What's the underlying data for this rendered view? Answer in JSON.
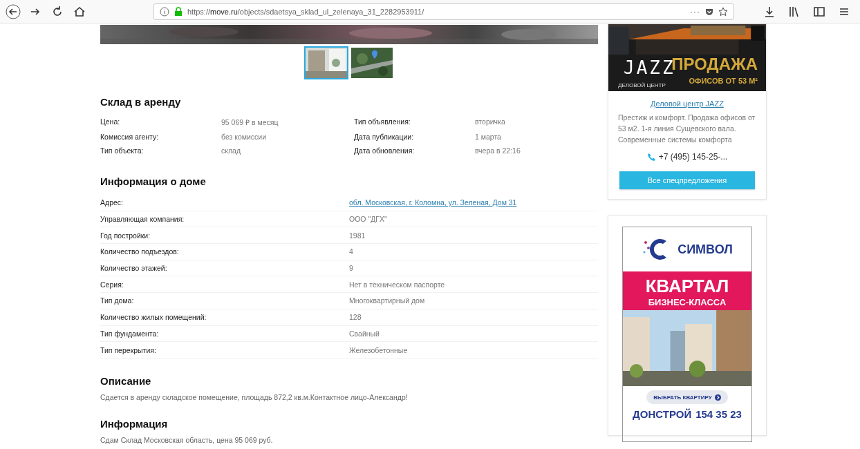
{
  "browser": {
    "url": "https://**move.ru**/objects/sdaetsya_sklad_ul_zelenaya_31_2282953911/",
    "page_actions": "···"
  },
  "gallery": {
    "thumbnails": [
      {
        "kind": "picture",
        "selected": true
      },
      {
        "kind": "map",
        "selected": false
      }
    ]
  },
  "listing": {
    "title": "Склад в аренду",
    "left_fields": [
      {
        "label": "Цена:",
        "value": "95 069 ₽ в месяц"
      },
      {
        "label": "Комиссия агенту:",
        "value": "без комиссии"
      },
      {
        "label": "Тип объекта:",
        "value": "склад"
      }
    ],
    "right_fields": [
      {
        "label": "Тип объявления:",
        "value": "вторичка"
      },
      {
        "label": "Дата публикации:",
        "value": "1 марта"
      },
      {
        "label": "Дата обновления:",
        "value": "вчера в 22:16"
      }
    ]
  },
  "house": {
    "title": "Информация о доме",
    "rows": [
      {
        "label": "Адрес:",
        "value": "обл. Московская, г. Коломна, ул. Зеленая, Дом 31",
        "kind": "link"
      },
      {
        "label": "Управляющая компания:",
        "value": "ООО \"ДГХ\"",
        "kind": "text"
      },
      {
        "label": "Год постройки:",
        "value": "1981",
        "kind": "text"
      },
      {
        "label": "Количество подъездов:",
        "value": "4",
        "kind": "text"
      },
      {
        "label": "Количество этажей:",
        "value": "9",
        "kind": "text"
      },
      {
        "label": "Серия:",
        "value": "Нет в техническом паспорте",
        "kind": "text"
      },
      {
        "label": "Тип дома:",
        "value": "Многоквартирный дом",
        "kind": "text"
      },
      {
        "label": "Количество жилых помещений:",
        "value": "128",
        "kind": "text"
      },
      {
        "label": "Тип фундамента:",
        "value": "Свайный",
        "kind": "text"
      },
      {
        "label": "Тип перекрытия:",
        "value": "Железобетонные",
        "kind": "text"
      }
    ]
  },
  "description": {
    "title": "Описание",
    "text": "Сдается в аренду складское помещение, площадь 872,2 кв.м.Контактное лицо-Александр!"
  },
  "information": {
    "title": "Информация",
    "text": "Сдам Склад Московская область, цена 95 069 руб."
  },
  "ad_jazz": {
    "logo": "JAZZ",
    "logo_caption": "ДЕЛОВОЙ ЦЕНТР",
    "headline": "ПРОДАЖА",
    "subline": "ОФИСОВ ОТ 53 М²",
    "link": "Деловой центр JAZZ",
    "text": "Престиж и комфорт. Продажа офисов от 53 м2. 1-я линия Сущевского вала. Современные системы комфорта",
    "phone": "+7 (495) 145-25-...",
    "button": "Все спецпредложения"
  },
  "ad_symbol": {
    "brand": "СИМВОЛ",
    "headline": "КВАРТАЛ",
    "subline": "БИЗНЕС-КЛАССА",
    "button": "ВЫБРАТЬ КВАРТИРУ",
    "developer": "ДОНСТРОЙ",
    "phone": "154 35 23"
  }
}
